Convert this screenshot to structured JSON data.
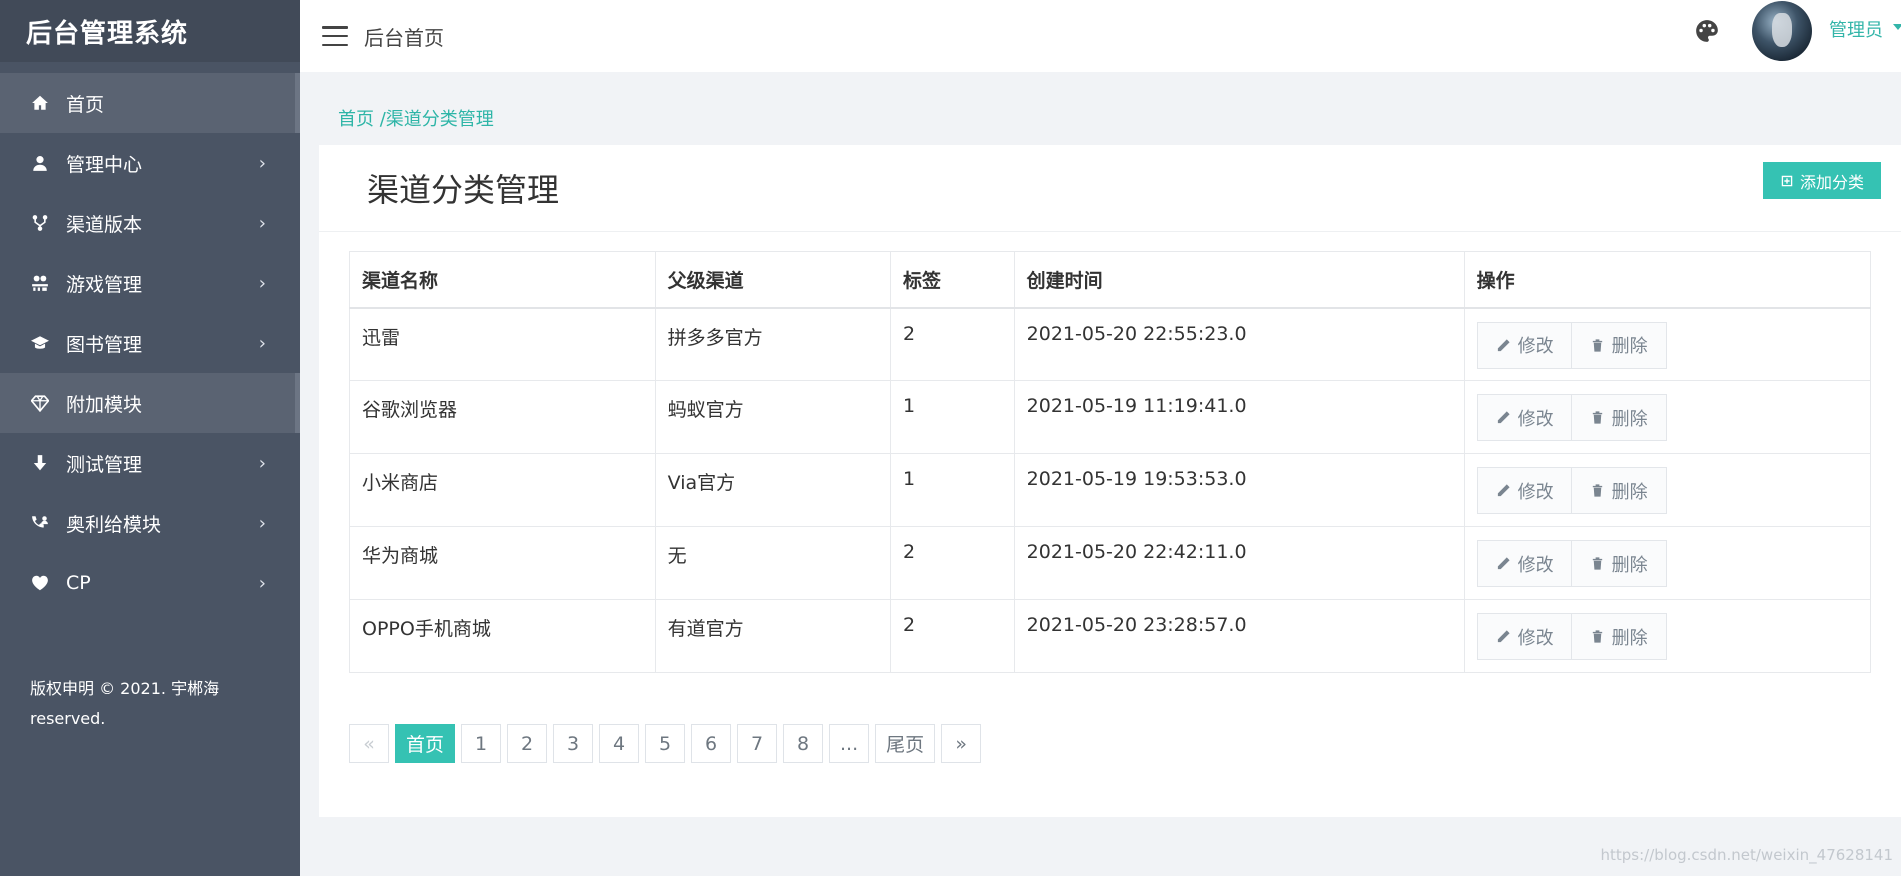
{
  "sidebar": {
    "brand": "后台管理系统",
    "items": [
      {
        "label": "首页",
        "icon": "home-icon",
        "has_children": false,
        "active": true
      },
      {
        "label": "管理中心",
        "icon": "user-icon",
        "has_children": true,
        "active": false
      },
      {
        "label": "渠道版本",
        "icon": "code-fork-icon",
        "has_children": true,
        "active": false
      },
      {
        "label": "游戏管理",
        "icon": "gamepad-icon",
        "has_children": true,
        "active": false
      },
      {
        "label": "图书管理",
        "icon": "graduation-cap-icon",
        "has_children": true,
        "active": false
      },
      {
        "label": "附加模块",
        "icon": "diamond-icon",
        "has_children": false,
        "active": true
      },
      {
        "label": "测试管理",
        "icon": "arrow-down-icon",
        "has_children": true,
        "active": false
      },
      {
        "label": "奥利给模块",
        "icon": "phone-user-icon",
        "has_children": true,
        "active": false
      },
      {
        "label": "CP",
        "icon": "heart-icon",
        "has_children": true,
        "active": false
      }
    ],
    "copyright_line1": "版权申明 © 2021. 宇郴海",
    "copyright_line2": "reserved."
  },
  "topbar": {
    "title": "后台首页",
    "user_name": "管理员",
    "palette_icon": "palette-icon"
  },
  "breadcrumb": {
    "home": "首页",
    "separator": " /",
    "current": "渠道分类管理"
  },
  "panel": {
    "title": "渠道分类管理",
    "add_button": "添加分类"
  },
  "table": {
    "columns": [
      "渠道名称",
      "父级渠道",
      "标签",
      "创建时间",
      "操作"
    ],
    "edit_label": "修改",
    "delete_label": "删除",
    "rows": [
      {
        "name": "迅雷",
        "parent": "拼多多官方",
        "tag": "2",
        "created": "2021-05-20 22:55:23.0"
      },
      {
        "name": "谷歌浏览器",
        "parent": "蚂蚁官方",
        "tag": "1",
        "created": "2021-05-19 11:19:41.0"
      },
      {
        "name": "小米商店",
        "parent": "Via官方",
        "tag": "1",
        "created": "2021-05-19 19:53:53.0"
      },
      {
        "name": "华为商城",
        "parent": "无",
        "tag": "2",
        "created": "2021-05-20 22:42:11.0"
      },
      {
        "name": "OPPO手机商城",
        "parent": "有道官方",
        "tag": "2",
        "created": "2021-05-20 23:28:57.0"
      }
    ]
  },
  "pagination": {
    "prev": "«",
    "first": "首页",
    "pages": [
      "1",
      "2",
      "3",
      "4",
      "5",
      "6",
      "7",
      "8"
    ],
    "ellipsis": "...",
    "last": "尾页",
    "next": "»",
    "current": "首页"
  },
  "watermark": "https://blog.csdn.net/weixin_47628141",
  "colors": {
    "sidebar_bg": "#4a5464",
    "accent": "#35c2b3",
    "link": "#2eb5a7"
  }
}
